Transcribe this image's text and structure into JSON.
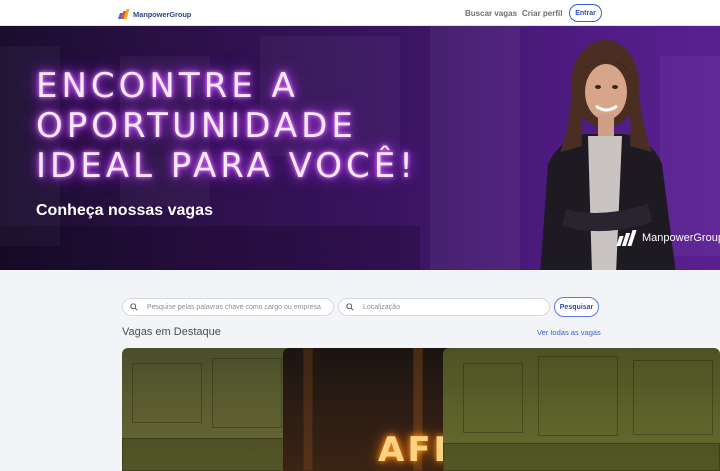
{
  "header": {
    "logo_text": "ManpowerGroup",
    "nav": [
      "Buscar vagas",
      "Criar perfil"
    ],
    "login_label": "Entrar"
  },
  "hero": {
    "title": "ENCONTRE A\nOPORTUNIDADE\nIDEAL PARA VOCÊ!",
    "subtitle": "Conheça nossas vagas",
    "brand": "ManpowerGroup"
  },
  "search": {
    "keyword_placeholder": "Pesquise pelas palavras chave como cargo ou empresa",
    "location_placeholder": "Localização",
    "button_label": "Pesquisar"
  },
  "featured": {
    "title": "Vagas em Destaque",
    "see_all": "Ver todas as vagas",
    "card2_text": "AFII"
  },
  "colors": {
    "brand_blue": "#2f4fb8",
    "hero_purple": "#3a1461",
    "neon": "#e880ff"
  }
}
